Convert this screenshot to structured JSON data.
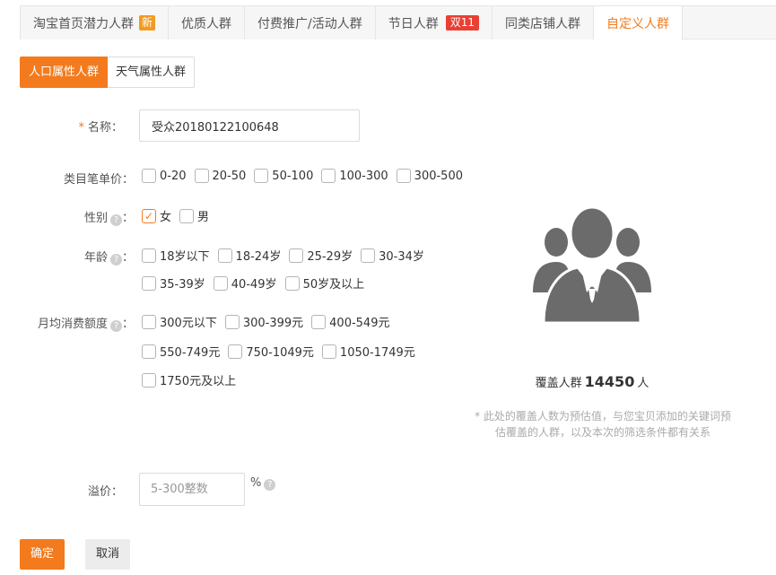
{
  "tabs": [
    {
      "label": "淘宝首页潜力人群",
      "badge": "新"
    },
    {
      "label": "优质人群"
    },
    {
      "label": "付费推广/活动人群"
    },
    {
      "label": "节日人群",
      "badge": "双11"
    },
    {
      "label": "同类店铺人群"
    },
    {
      "label": "自定义人群"
    }
  ],
  "subtabs": [
    "人口属性人群",
    "天气属性人群"
  ],
  "form": {
    "name_label": "名称：",
    "name_required": "*",
    "name_value": "受众20180122100648",
    "price_label": "类目笔单价：",
    "price_options": [
      "0-20",
      "20-50",
      "50-100",
      "100-300",
      "300-500"
    ],
    "gender_label": "性别",
    "gender_options": [
      {
        "label": "女",
        "checked": true
      },
      {
        "label": "男",
        "checked": false
      }
    ],
    "age_label": "年龄",
    "age_options_row1": [
      "18岁以下",
      "18-24岁",
      "25-29岁",
      "30-34岁"
    ],
    "age_options_row2": [
      "35-39岁",
      "40-49岁",
      "50岁及以上"
    ],
    "spend_label": "月均消费额度",
    "spend_options_row1": [
      "300元以下",
      "300-399元",
      "400-549元"
    ],
    "spend_options_row2": [
      "550-749元",
      "750-1049元",
      "1050-1749元"
    ],
    "spend_options_row3": [
      "1750元及以上"
    ],
    "premium_label": "溢价：",
    "premium_placeholder": "5-300整数",
    "premium_unit": "%",
    "colon": "："
  },
  "coverage": {
    "prefix": "覆盖人群",
    "count": "14450",
    "suffix": "人",
    "note": "* 此处的覆盖人数为预估值，与您宝贝添加的关键词预估覆盖的人群，以及本次的筛选条件都有关系"
  },
  "buttons": {
    "ok": "确定",
    "cancel": "取消"
  },
  "colors": {
    "accent": "#f37b1d",
    "badge_new": "#f39a1f",
    "badge_red": "#ea3f34",
    "icon": "#6b6b6b"
  }
}
